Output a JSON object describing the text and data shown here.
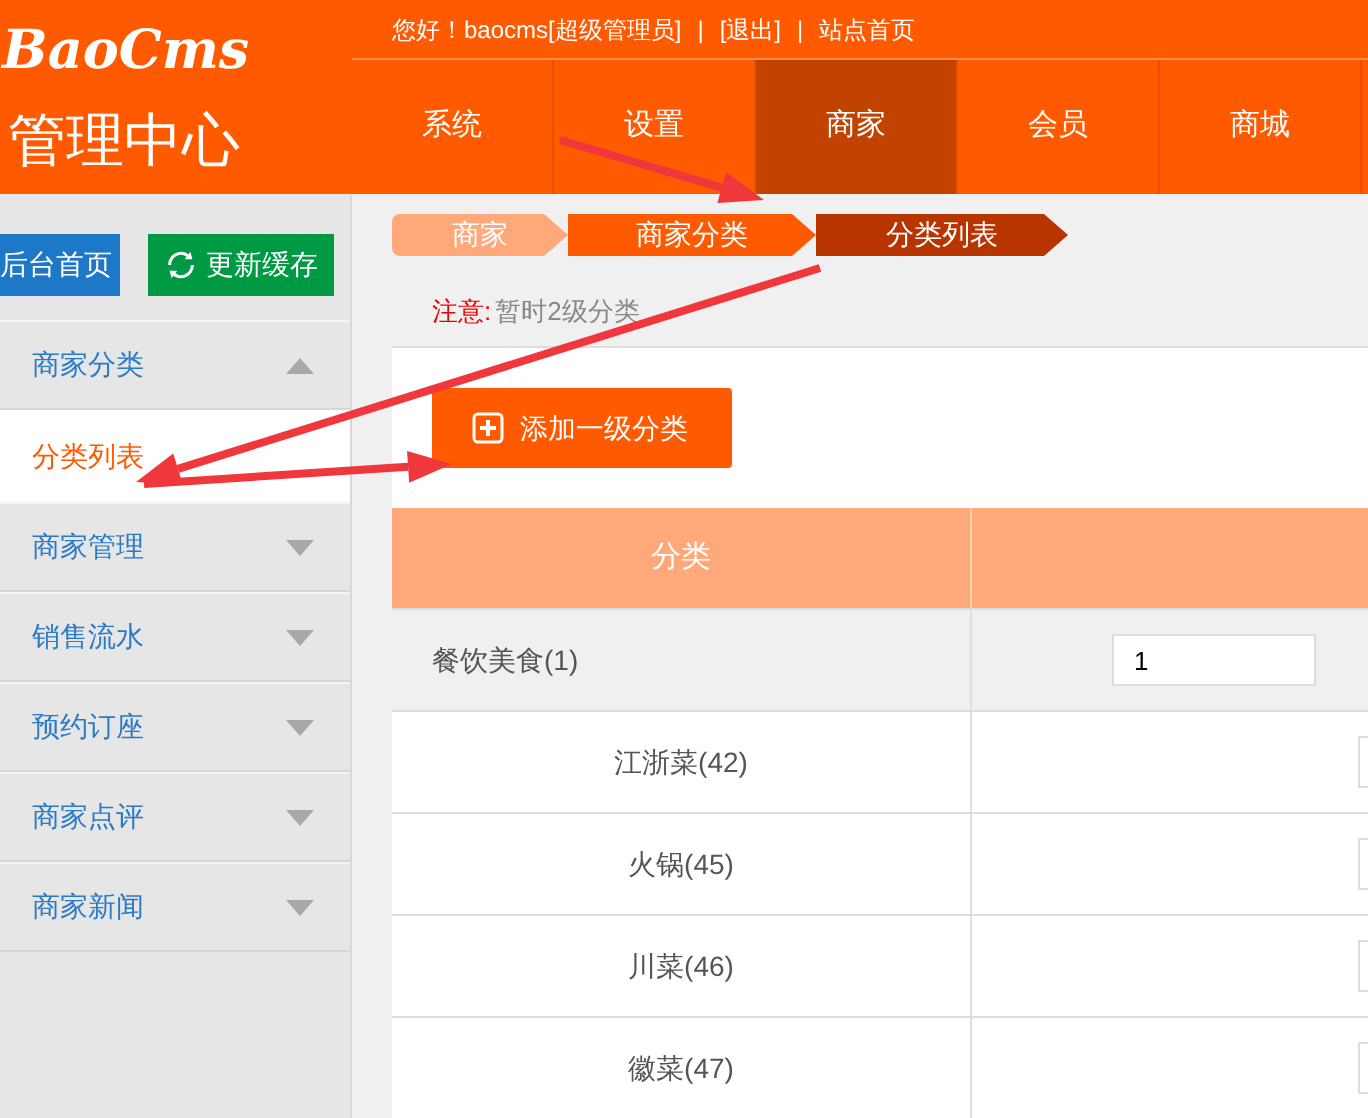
{
  "logo": {
    "brand": "BaoCms",
    "subtitle": "管理中心"
  },
  "top_bar": {
    "greeting": "您好！baocms[超级管理员]",
    "separator": "|",
    "links": [
      "[退出]",
      "站点首页"
    ]
  },
  "nav_tabs": [
    {
      "label": "系统",
      "selected": false
    },
    {
      "label": "设置",
      "selected": false
    },
    {
      "label": "商家",
      "selected": true
    },
    {
      "label": "会员",
      "selected": false
    },
    {
      "label": "商城",
      "selected": false
    }
  ],
  "sidebar": {
    "buttons": [
      {
        "label": "后台首页",
        "kind": "home"
      },
      {
        "label": "更新缓存",
        "kind": "refresh"
      }
    ],
    "items": [
      {
        "label": "商家分类",
        "expanded": true,
        "children": [
          {
            "label": "分类列表",
            "selected": true
          }
        ]
      },
      {
        "label": "商家管理",
        "expanded": false
      },
      {
        "label": "销售流水",
        "expanded": false
      },
      {
        "label": "预约订座",
        "expanded": false
      },
      {
        "label": "商家点评",
        "expanded": false
      },
      {
        "label": "商家新闻",
        "expanded": false
      }
    ]
  },
  "breadcrumb": [
    "商家",
    "商家分类",
    "分类列表"
  ],
  "note": {
    "label": "注意:",
    "text": "暂时2级分类"
  },
  "add_button": "添加一级分类",
  "table": {
    "columns": [
      "分类"
    ],
    "rows": [
      {
        "kind": "parent",
        "name": "餐饮美食(1)",
        "order": "1"
      },
      {
        "kind": "child",
        "name": "江浙菜(42)"
      },
      {
        "kind": "child",
        "name": "火锅(45)"
      },
      {
        "kind": "child",
        "name": "川菜(46)"
      },
      {
        "kind": "child",
        "name": "徽菜(47)"
      }
    ]
  }
}
